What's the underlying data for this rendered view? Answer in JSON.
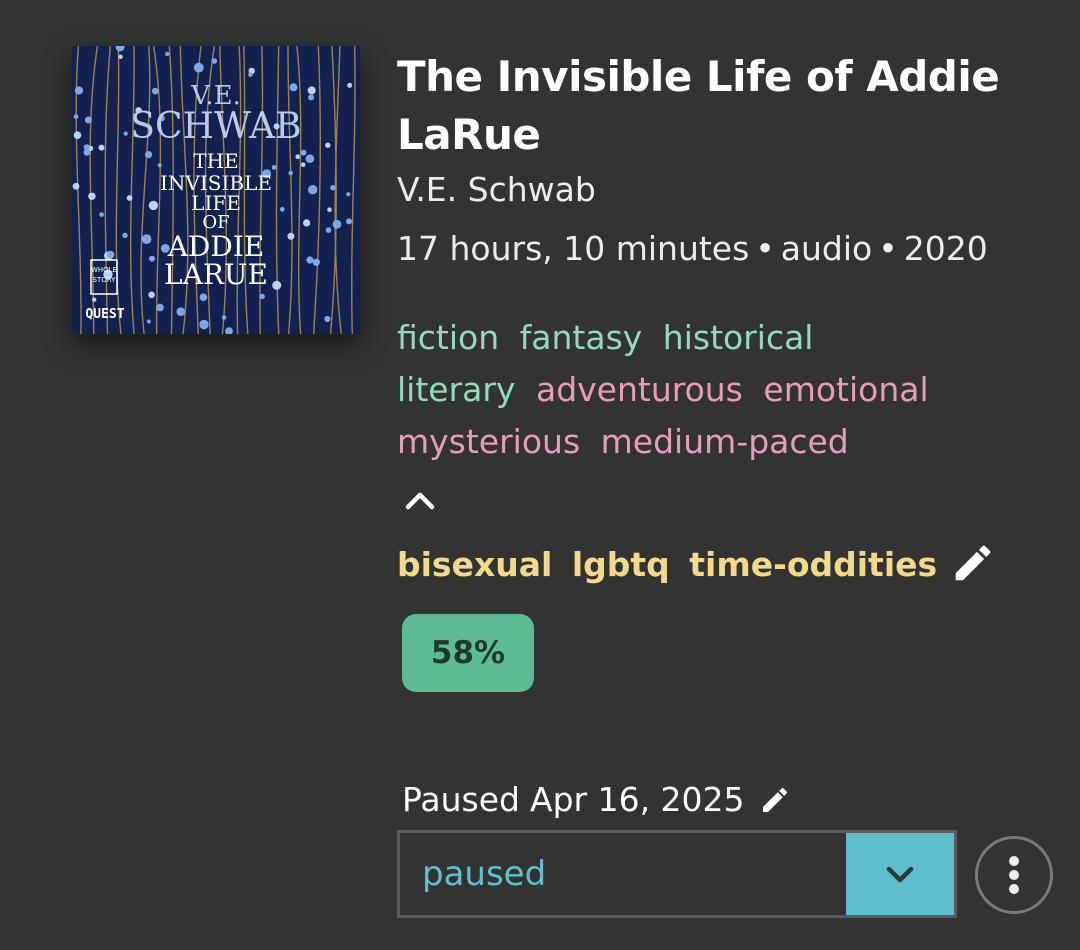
{
  "book": {
    "title": "The Invisible Life of Addie LaRue",
    "author": "V.E. Schwab",
    "duration": "17 hours, 10 minutes",
    "format": "audio",
    "year": "2020",
    "separator": "•"
  },
  "cover": {
    "author_line1": "V.E.",
    "author_line2": "SCHWAB",
    "title_line1": "THE",
    "title_line2": "INVISIBLE",
    "title_line3": "LIFE",
    "title_line4": "OF",
    "title_line5": "ADDIE",
    "title_line6": "LARUE",
    "publisher_logo_line1": "WHOLE",
    "publisher_logo_line2": "STORY",
    "publisher": "QUEST",
    "background_color": "#122150"
  },
  "tags": {
    "genres": [
      "fiction",
      "fantasy",
      "historical",
      "literary"
    ],
    "moods": [
      "adventurous",
      "emotional",
      "mysterious",
      "medium-paced"
    ],
    "custom": [
      "bisexual",
      "lgbtq",
      "time-oddities"
    ],
    "genre_color": "#94dbbc",
    "mood_color": "#e69dbb",
    "custom_color": "#f2d98e",
    "collapse_icon": "chevron-up-icon",
    "edit_icon": "pencil-icon"
  },
  "progress": {
    "label": "58%",
    "value": 58,
    "color": "#5ebc94"
  },
  "status": {
    "state_label": "Paused",
    "date": "Apr 16, 2025",
    "selected": "paused",
    "accent_color": "#5fbecb",
    "dropdown_icon": "chevron-down-icon",
    "more_icon": "more-vertical-icon"
  }
}
